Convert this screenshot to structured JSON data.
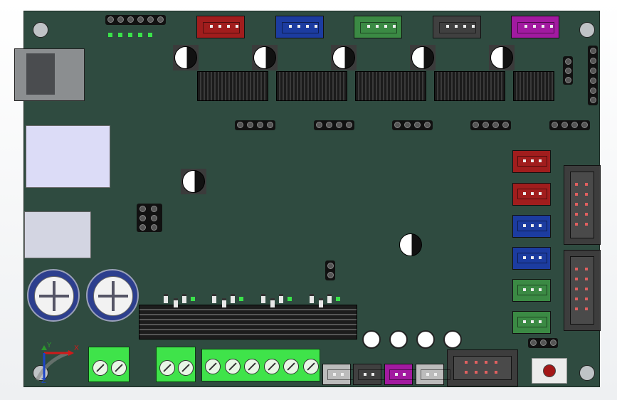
{
  "scene": {
    "type": "PCB 3D model view",
    "board_color": "#2f4b40"
  },
  "connectors_top": [
    {
      "name": "connector-red-top",
      "color": "#a11d1d"
    },
    {
      "name": "connector-blue-top",
      "color": "#1c3ca0"
    },
    {
      "name": "connector-green-top",
      "color": "#3b8a44"
    },
    {
      "name": "connector-black-top",
      "color": "#404040"
    },
    {
      "name": "connector-magenta-top",
      "color": "#a21aa0"
    }
  ],
  "connectors_right": [
    {
      "name": "connector-red-right-1",
      "color": "#a11d1d"
    },
    {
      "name": "connector-red-right-2",
      "color": "#a11d1d"
    },
    {
      "name": "connector-blue-right-1",
      "color": "#1c3ca0"
    },
    {
      "name": "connector-blue-right-2",
      "color": "#1c3ca0"
    },
    {
      "name": "connector-green-right-1",
      "color": "#3b8a44"
    },
    {
      "name": "connector-green-right-2",
      "color": "#3b8a44"
    }
  ],
  "connectors_bottom": [
    {
      "name": "connector-grey-bottom-1",
      "color": "#bcbcbc"
    },
    {
      "name": "connector-black-bottom",
      "color": "#404040"
    },
    {
      "name": "connector-magenta-bottom",
      "color": "#a21aa0"
    },
    {
      "name": "connector-grey-bottom-2",
      "color": "#bcbcbc"
    }
  ],
  "axis": {
    "x": "X",
    "y": "Y",
    "z": "Z"
  }
}
